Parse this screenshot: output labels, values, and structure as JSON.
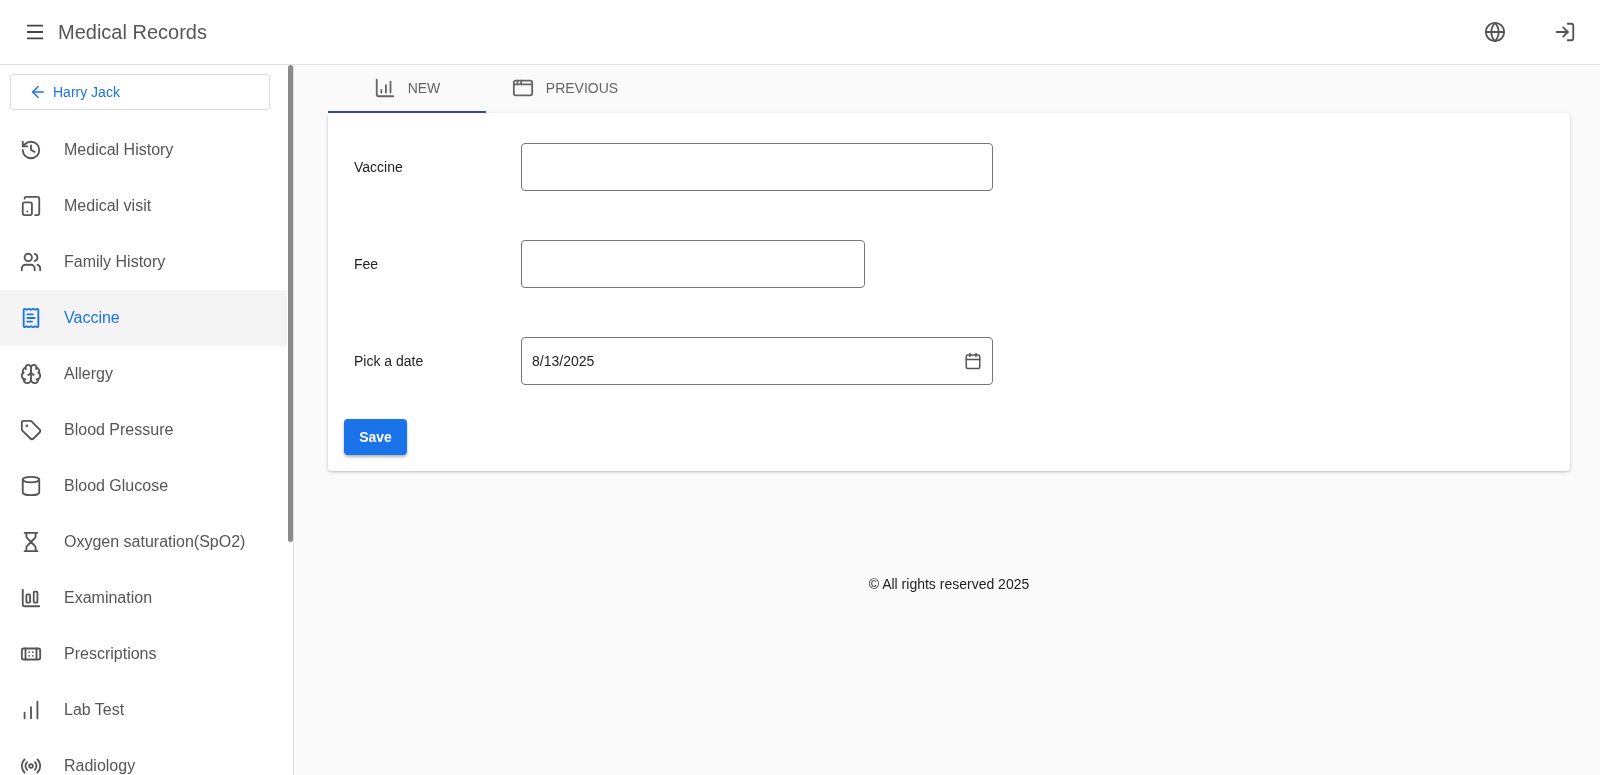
{
  "app_bar": {
    "title": "Medical Records"
  },
  "sidebar": {
    "back_button": "Harry Jack",
    "items": [
      {
        "label": "Medical History",
        "selected": false
      },
      {
        "label": "Medical visit",
        "selected": false
      },
      {
        "label": "Family History",
        "selected": false
      },
      {
        "label": "Vaccine",
        "selected": true
      },
      {
        "label": "Allergy",
        "selected": false
      },
      {
        "label": "Blood Pressure",
        "selected": false
      },
      {
        "label": "Blood Glucose",
        "selected": false
      },
      {
        "label": "Oxygen saturation(SpO2)",
        "selected": false
      },
      {
        "label": "Examination",
        "selected": false
      },
      {
        "label": "Prescriptions",
        "selected": false
      },
      {
        "label": "Lab Test",
        "selected": false
      },
      {
        "label": "Radiology",
        "selected": false
      }
    ]
  },
  "tabs": [
    {
      "label": "NEW",
      "selected": true
    },
    {
      "label": "PREVIOUS",
      "selected": false
    }
  ],
  "form": {
    "fields": [
      {
        "kind": "text",
        "label": "Vaccine"
      },
      {
        "kind": "text",
        "label": "Fee"
      },
      {
        "kind": "date",
        "label": "Pick a date",
        "value": "8/13/2025"
      }
    ],
    "save_button": "Save"
  },
  "footer": "© All rights reserved 2025"
}
